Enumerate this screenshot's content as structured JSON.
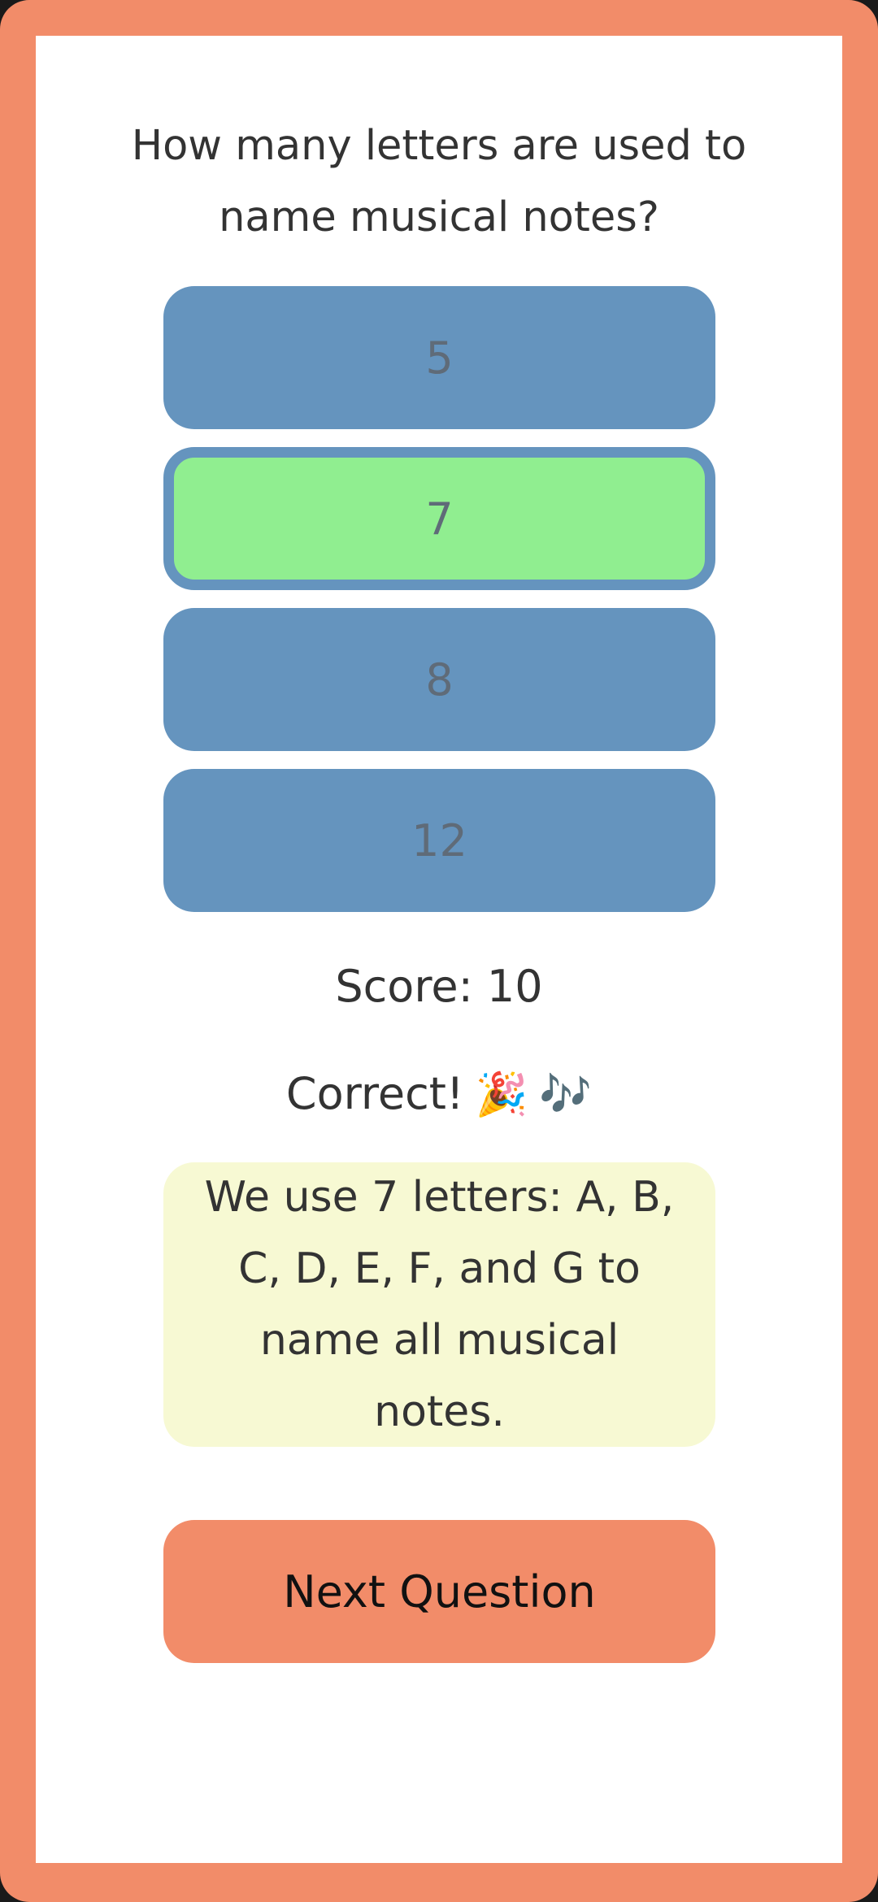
{
  "quiz": {
    "question": "How many letters are used to name musical notes?",
    "options": [
      {
        "label": "5",
        "selected": false
      },
      {
        "label": "7",
        "selected": true
      },
      {
        "label": "8",
        "selected": false
      },
      {
        "label": "12",
        "selected": false
      }
    ],
    "score_text": "Score: 10",
    "feedback_text": "Correct!",
    "feedback_emojis": [
      "🎉",
      "🎶"
    ],
    "explanation": "We use 7 letters: A, B, C, D, E, F, and G to name all musical notes.",
    "next_button_label": "Next Question"
  },
  "colors": {
    "frame": "#f28c69",
    "option_bg": "#6594be",
    "option_selected_bg": "#90ee90",
    "option_text": "#5f6b78",
    "explanation_bg": "#f7f9d3",
    "next_button_bg": "#f28c69"
  }
}
